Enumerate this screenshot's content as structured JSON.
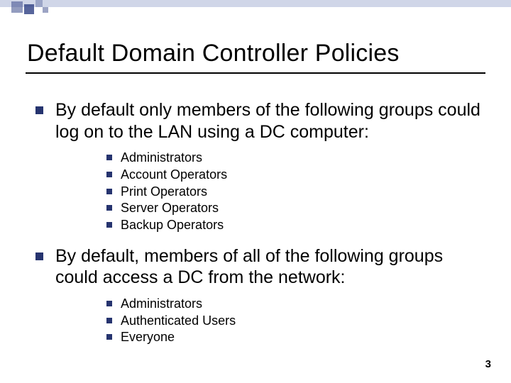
{
  "title": "Default Domain Controller Policies",
  "bullets": [
    {
      "text": "By default only members of the following groups could log on to the LAN using a DC computer:",
      "sub": [
        "Administrators",
        "Account Operators",
        "Print Operators",
        "Server Operators",
        "Backup Operators"
      ]
    },
    {
      "text": "By default, members of all of the following groups could access a DC from the network:",
      "sub": [
        "Administrators",
        "Authenticated Users",
        "Everyone"
      ]
    }
  ],
  "page_number": "3"
}
